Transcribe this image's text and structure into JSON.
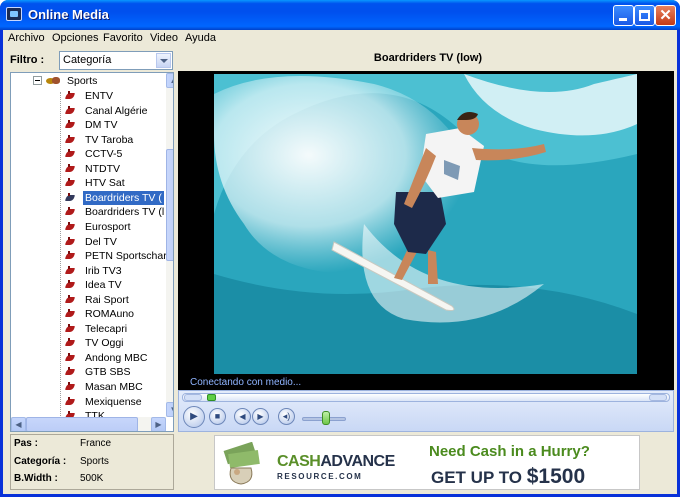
{
  "window": {
    "title": "Online Media"
  },
  "menu": [
    "Archivo",
    "Opciones",
    "Favorito",
    "Video",
    "Ayuda"
  ],
  "filter": {
    "label": "Filtro :",
    "value": "Categoría"
  },
  "tree": {
    "category": "Sports",
    "channels": [
      "ENTV",
      "Canal Algérie",
      "DM TV",
      "TV Taroba",
      "CCTV-5",
      "NTDTV",
      "HTV Sat",
      "Boardriders TV (",
      "Boardriders TV (l",
      "Eurosport",
      "Del TV",
      "PETN Sportschar",
      "Irib TV3",
      "Idea TV",
      "Rai Sport",
      "ROMAuno",
      "Telecapri",
      "TV Oggi",
      "Andong MBC",
      "GTB SBS",
      "Masan MBC",
      "Mexiquense",
      "TTK"
    ],
    "selected_index": 7
  },
  "info": [
    {
      "key": "Pa­s :",
      "value": "France"
    },
    {
      "key": "Categoría :",
      "value": "Sports"
    },
    {
      "key": "B.Width :",
      "value": "500K"
    }
  ],
  "player": {
    "channel_title": "Boardriders TV (low)",
    "status": "Conectando con medio...",
    "controls": [
      "play-icon",
      "stop-icon",
      "previous-icon",
      "next-icon",
      "volume-icon"
    ]
  },
  "ad": {
    "logo_part1": "CASH",
    "logo_part2": "ADVANCE",
    "logo_sub": "RESOURCE.COM",
    "headline": "Need Cash in a Hurry?",
    "offer_prefix": "GET UP TO",
    "offer_amount": "$1500"
  },
  "colors": {
    "titlebar": "#0054e3",
    "selection": "#316ac5",
    "ad_green": "#4b8b1e",
    "ad_navy": "#25324a"
  }
}
